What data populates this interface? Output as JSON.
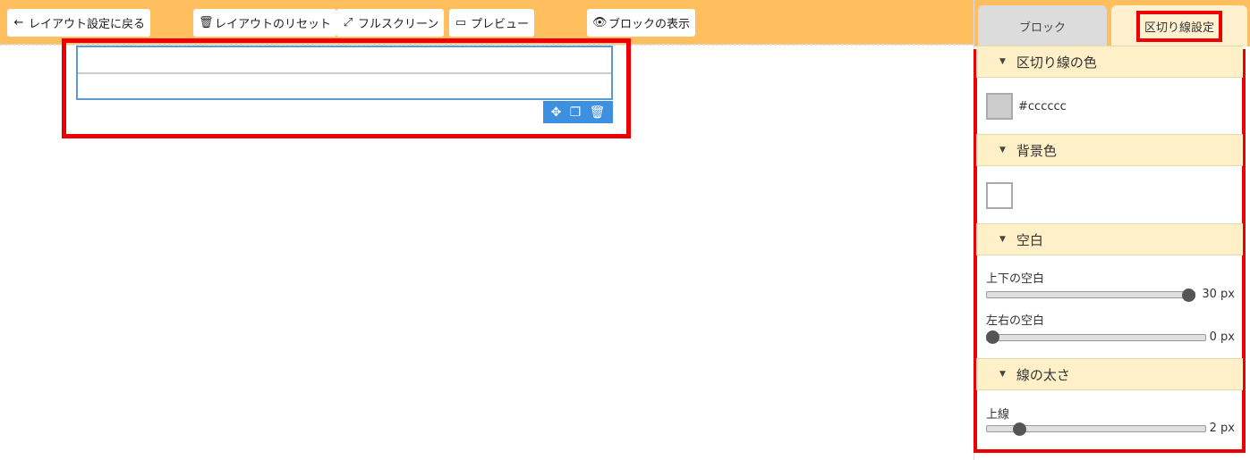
{
  "toolbar": {
    "back": {
      "icon": "←",
      "label": "レイアウト設定に戻る"
    },
    "reset": {
      "icon": "🗑",
      "label": "レイアウトのリセット"
    },
    "fullscreen": {
      "icon": "⤢",
      "label": "フルスクリーン"
    },
    "preview": {
      "icon": "▭",
      "label": "プレビュー"
    },
    "show_blocks": {
      "icon": "👁",
      "label": "ブロックの表示"
    }
  },
  "block_tools": {
    "move": "✥",
    "copy": "❐",
    "delete": "🗑"
  },
  "tabs": {
    "block": "ブロック",
    "divider": "区切り線設定"
  },
  "sections": {
    "line_color": {
      "title": "区切り線の色",
      "value": "#cccccc"
    },
    "bg_color": {
      "title": "背景色"
    },
    "spacing": {
      "title": "空白",
      "vertical": {
        "label": "上下の空白",
        "value": "30 px",
        "fraction": 1.0
      },
      "horizontal": {
        "label": "左右の空白",
        "value": "0 px",
        "fraction": 0.0
      }
    },
    "thickness": {
      "title": "線の太さ",
      "top": {
        "label": "上線",
        "value": "2 px",
        "fraction": 0.13
      }
    }
  },
  "caret": "▼",
  "colors": {
    "toolbar": "#ffbf5f",
    "highlight": "#ee0000",
    "block_border": "#5b9bd5",
    "tools_bg": "#3d8fe0",
    "section_bg": "#fff0c8"
  }
}
